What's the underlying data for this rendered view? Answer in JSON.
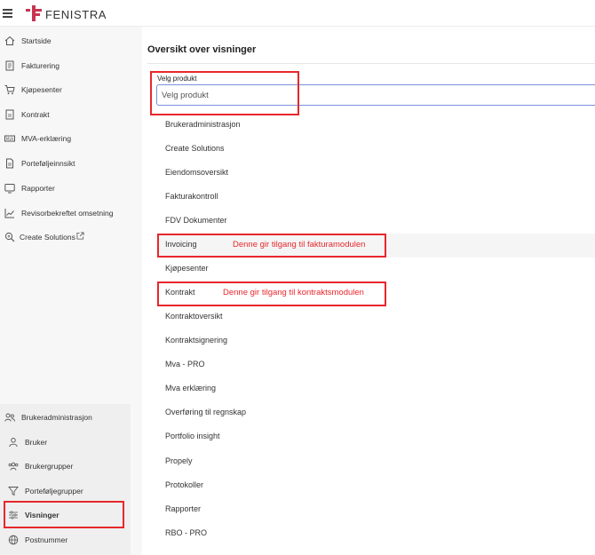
{
  "header": {
    "logo_text": "FENISTRA",
    "brand_color": "#c8344f"
  },
  "sidebar": {
    "items": [
      {
        "label": "Startside",
        "icon": "home-icon"
      },
      {
        "label": "Fakturering",
        "icon": "receipt-icon"
      },
      {
        "label": "Kjøpesenter",
        "icon": "cart-icon"
      },
      {
        "label": "Kontrakt",
        "icon": "contract-icon"
      },
      {
        "label": "MVA-erklæring",
        "icon": "vat-icon"
      },
      {
        "label": "Porteføljeinnsikt",
        "icon": "document-icon"
      },
      {
        "label": "Rapporter",
        "icon": "monitor-icon"
      },
      {
        "label": "Revisorbekreftet omsetning",
        "icon": "chart-line-icon"
      },
      {
        "label": "Create Solutions",
        "icon": "search-icon",
        "external": "external-link-icon"
      }
    ],
    "admin": {
      "title": "Brukeradministrasjon",
      "items": [
        {
          "label": "Bruker",
          "icon": "user-icon"
        },
        {
          "label": "Brukergrupper",
          "icon": "users-icon"
        },
        {
          "label": "Porteføljegrupper",
          "icon": "filter-icon"
        },
        {
          "label": "Visninger",
          "icon": "sliders-icon",
          "active": true
        },
        {
          "label": "Postnummer",
          "icon": "globe-icon"
        }
      ]
    }
  },
  "main": {
    "title": "Oversikt over visninger",
    "select": {
      "label": "Velg produkt",
      "placeholder": "Velg produkt"
    },
    "options": [
      "Brukeradministrasjon",
      "Create Solutions",
      "Eiendomsoversikt",
      "Fakturakontroll",
      "FDV Dokumenter",
      "Invoicing",
      "Kjøpesenter",
      "Kontrakt",
      "Kontraktoversikt",
      "Kontraktsignering",
      "Mva - PRO",
      "Mva erklæring",
      "Overføring til regnskap",
      "Portfolio insight",
      "Propely",
      "Protokoller",
      "Rapporter",
      "RBO - PRO"
    ],
    "annotations": {
      "invoicing": "Denne gir tilgang til fakturamodulen",
      "kontrakt": "Denne gir tilgang til kontraktsmodulen"
    }
  },
  "colors": {
    "annotation_red": "#e8272b",
    "focus_border": "#7b8fd9"
  }
}
